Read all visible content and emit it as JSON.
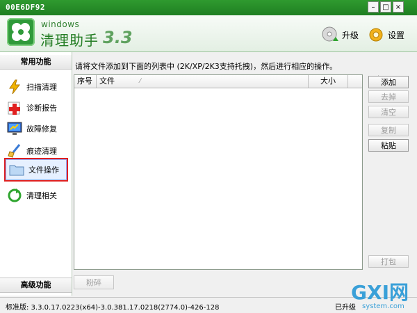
{
  "window": {
    "title": "00E6DF92"
  },
  "header": {
    "brand_small": "windows",
    "brand_name": "清理助手",
    "brand_version": "3.3",
    "upgrade_label": "升级",
    "settings_label": "设置"
  },
  "sidebar": {
    "common_title": "常用功能",
    "advanced_title": "高级功能",
    "items": [
      {
        "label": "扫描清理",
        "icon": "lightning-icon"
      },
      {
        "label": "诊断报告",
        "icon": "medical-cross-icon"
      },
      {
        "label": "故障修复",
        "icon": "monitor-repair-icon"
      },
      {
        "label": "痕迹清理",
        "icon": "broom-icon"
      },
      {
        "label": "文件操作",
        "icon": "folder-icon",
        "selected": true
      },
      {
        "label": "清理相关",
        "icon": "recycle-icon"
      }
    ]
  },
  "main": {
    "instruction": "请将文件添加到下面的列表中 (2K/XP/2K3支持托拽)，然后进行相应的操作。",
    "columns": {
      "seq": "序号",
      "file": "文件",
      "size": "大小"
    },
    "shred_button": "粉碎"
  },
  "actions": {
    "add": "添加",
    "remove": "去掉",
    "clear": "清空",
    "copy": "复制",
    "paste": "粘贴",
    "pack": "打包"
  },
  "status": {
    "version": "标准版: 3.3.0.17.0223(x64)-3.0.381.17.0218(2774.0)-426-128",
    "right": "已升级"
  },
  "watermark": {
    "text1": "GXI网",
    "text2": "system.com"
  }
}
